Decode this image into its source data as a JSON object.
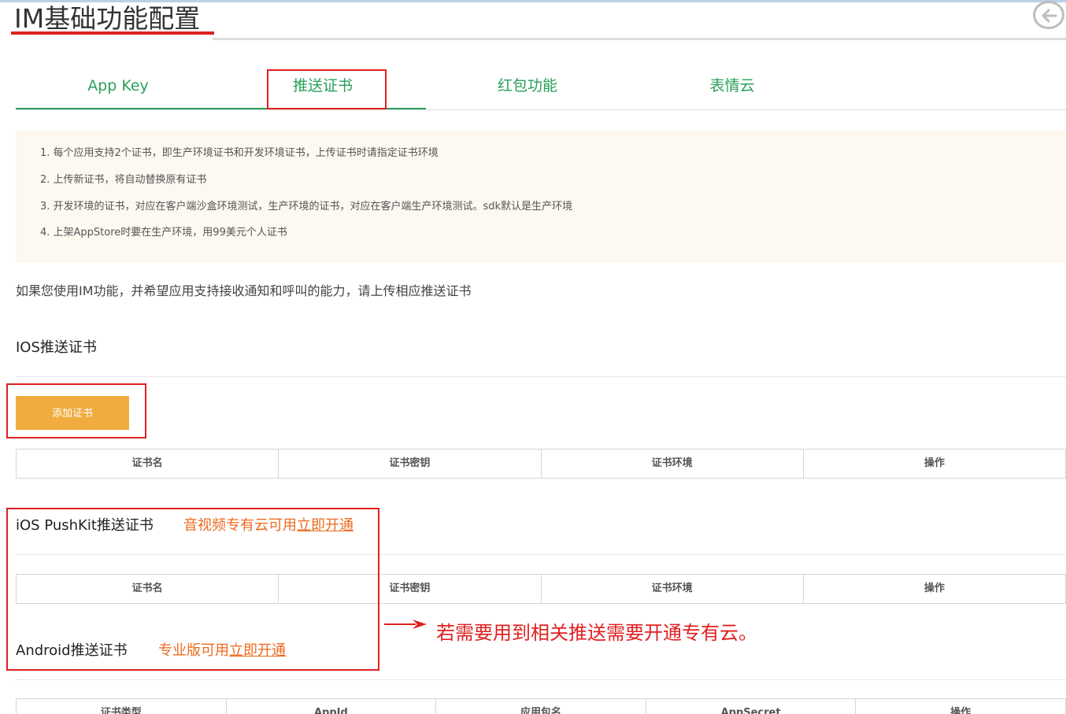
{
  "page": {
    "title": "IM基础功能配置",
    "back_icon": "arrow-left-circle-icon"
  },
  "tabs": [
    {
      "label": "App Key",
      "active": false
    },
    {
      "label": "推送证书",
      "active": true
    },
    {
      "label": "红包功能",
      "active": false
    },
    {
      "label": "表情云",
      "active": false
    }
  ],
  "notice": {
    "items": [
      "1. 每个应用支持2个证书，即生产环境证书和开发环境证书，上传证书时请指定证书环境",
      "2. 上传新证书，将自动替换原有证书",
      "3. 开发环境的证书，对应在客户端沙盒环境测试，生产环境的证书，对应在客户端生产环境测试。sdk默认是生产环境",
      "4. 上架AppStore时要在生产环境，用99美元个人证书"
    ]
  },
  "intro": "如果您使用IM功能，并希望应用支持接收通知和呼叫的能力，请上传相应推送证书",
  "ios": {
    "title": "IOS推送证书",
    "add_button": "添加证书",
    "columns": [
      "证书名",
      "证书密钥",
      "证书环境",
      "操作"
    ]
  },
  "pushkit": {
    "title": "iOS PushKit推送证书",
    "promo_text": "音视频专有云可用",
    "promo_link": "立即开通",
    "columns": [
      "证书名",
      "证书密钥",
      "证书环境",
      "操作"
    ]
  },
  "android": {
    "title": "Android推送证书",
    "promo_text": "专业版可用",
    "promo_link": "立即开通",
    "columns": [
      "证书类型",
      "AppId",
      "应用包名",
      "AppSecret",
      "操作"
    ]
  },
  "annotation": {
    "text": "若需要用到相关推送需要开通专有云。"
  },
  "colors": {
    "accent_green": "#2aa05a",
    "button_orange": "#f1ac3f",
    "promo_orange": "#ee6a1e",
    "annotation_red": "#e02020"
  }
}
